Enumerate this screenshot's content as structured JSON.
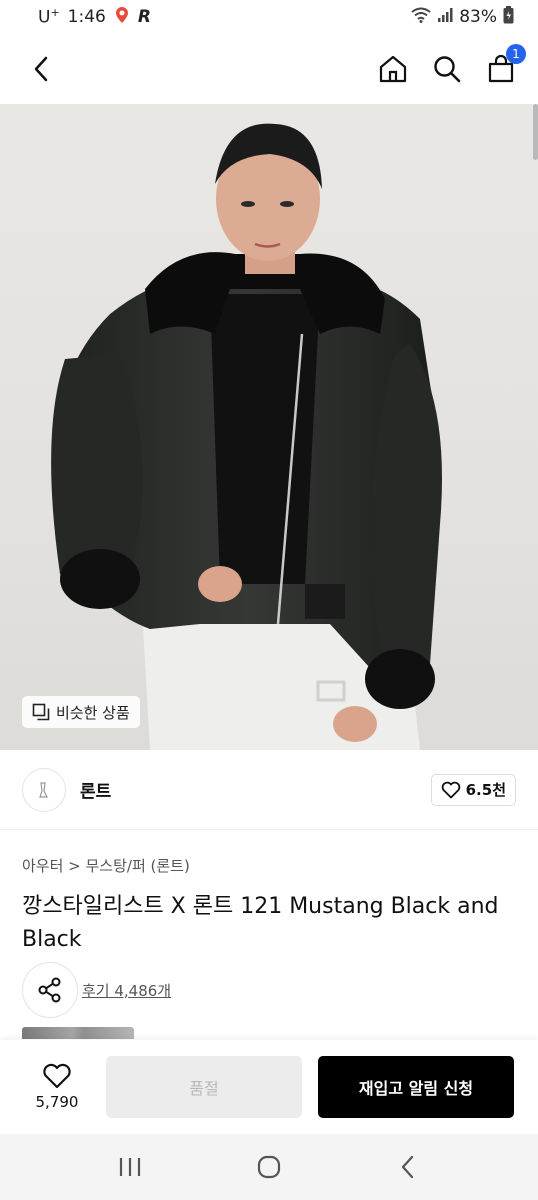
{
  "status_bar": {
    "carrier": "U",
    "carrier_sup": "+",
    "time": "1:46",
    "battery": "83%"
  },
  "header": {
    "cart_count": "1"
  },
  "hero": {
    "similar_label": "비슷한 상품"
  },
  "brand": {
    "name": "론트",
    "likes": "6.5천"
  },
  "product": {
    "breadcrumb": "아우터 > 무스탕/퍼 (론트)",
    "title": "깡스타일리스트 X 론트 121 Mustang Black and Black",
    "reviews": "후기 4,486개"
  },
  "action_bar": {
    "wish_count": "5,790",
    "soldout_label": "품절",
    "restock_label": "재입고 알림 신청"
  },
  "colors": {
    "accent": "#2563eb",
    "primary_button": "#000000",
    "disabled_button": "#ececec"
  }
}
